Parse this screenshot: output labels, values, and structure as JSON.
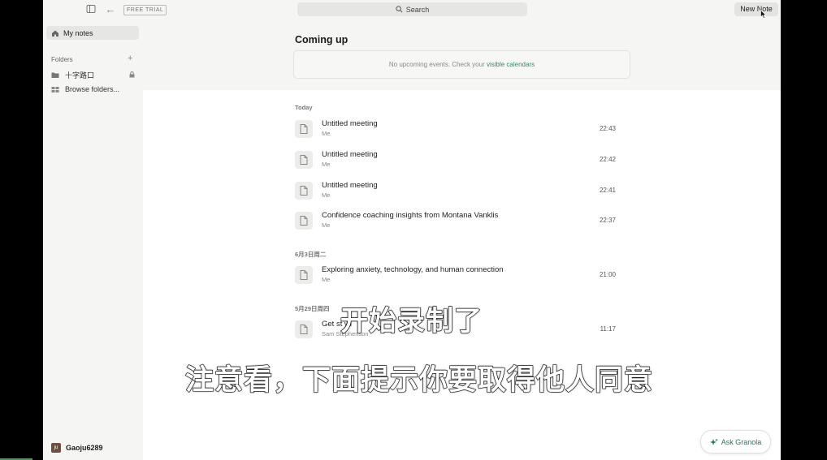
{
  "topbar": {
    "trial_badge": "FREE TRIAL",
    "search_label": "Search",
    "new_note_label": "New Note"
  },
  "sidebar": {
    "my_notes_label": "My notes",
    "folders_header": "Folders",
    "folders": [
      {
        "label": "十字路口",
        "locked": true
      },
      {
        "label": "Browse folders..."
      }
    ],
    "user": {
      "initials": "ju",
      "name": "Gaoju6289"
    }
  },
  "main": {
    "coming_up_title": "Coming up",
    "events_text": "No upcoming events. Check your ",
    "events_link": "visible calendars",
    "groups": [
      {
        "header": "Today",
        "notes": [
          {
            "title": "Untitled meeting",
            "author": "Me",
            "time": "22:43"
          },
          {
            "title": "Untitled meeting",
            "author": "Me",
            "time": "22:42"
          },
          {
            "title": "Untitled meeting",
            "author": "Me",
            "time": "22:41"
          },
          {
            "title": "Confidence coaching insights from Montana Vanklis",
            "author": "Me",
            "time": "22:37"
          }
        ]
      },
      {
        "header": "6月3日周二",
        "notes": [
          {
            "title": "Exploring anxiety, technology, and human connection",
            "author": "Me",
            "time": "21:00"
          }
        ]
      },
      {
        "header": "5月29日周四",
        "notes": [
          {
            "title": "Get st     wi",
            "author": "Sam Stephenson",
            "time": "11:17"
          }
        ]
      }
    ]
  },
  "subtitles": {
    "line1": "开始录制了",
    "line2": "注意看，下面提示你要取得他人同意"
  },
  "ask_button_label": "Ask Granola",
  "colors": {
    "accent": "#2f8f6e",
    "background": "#f5f5f4"
  }
}
